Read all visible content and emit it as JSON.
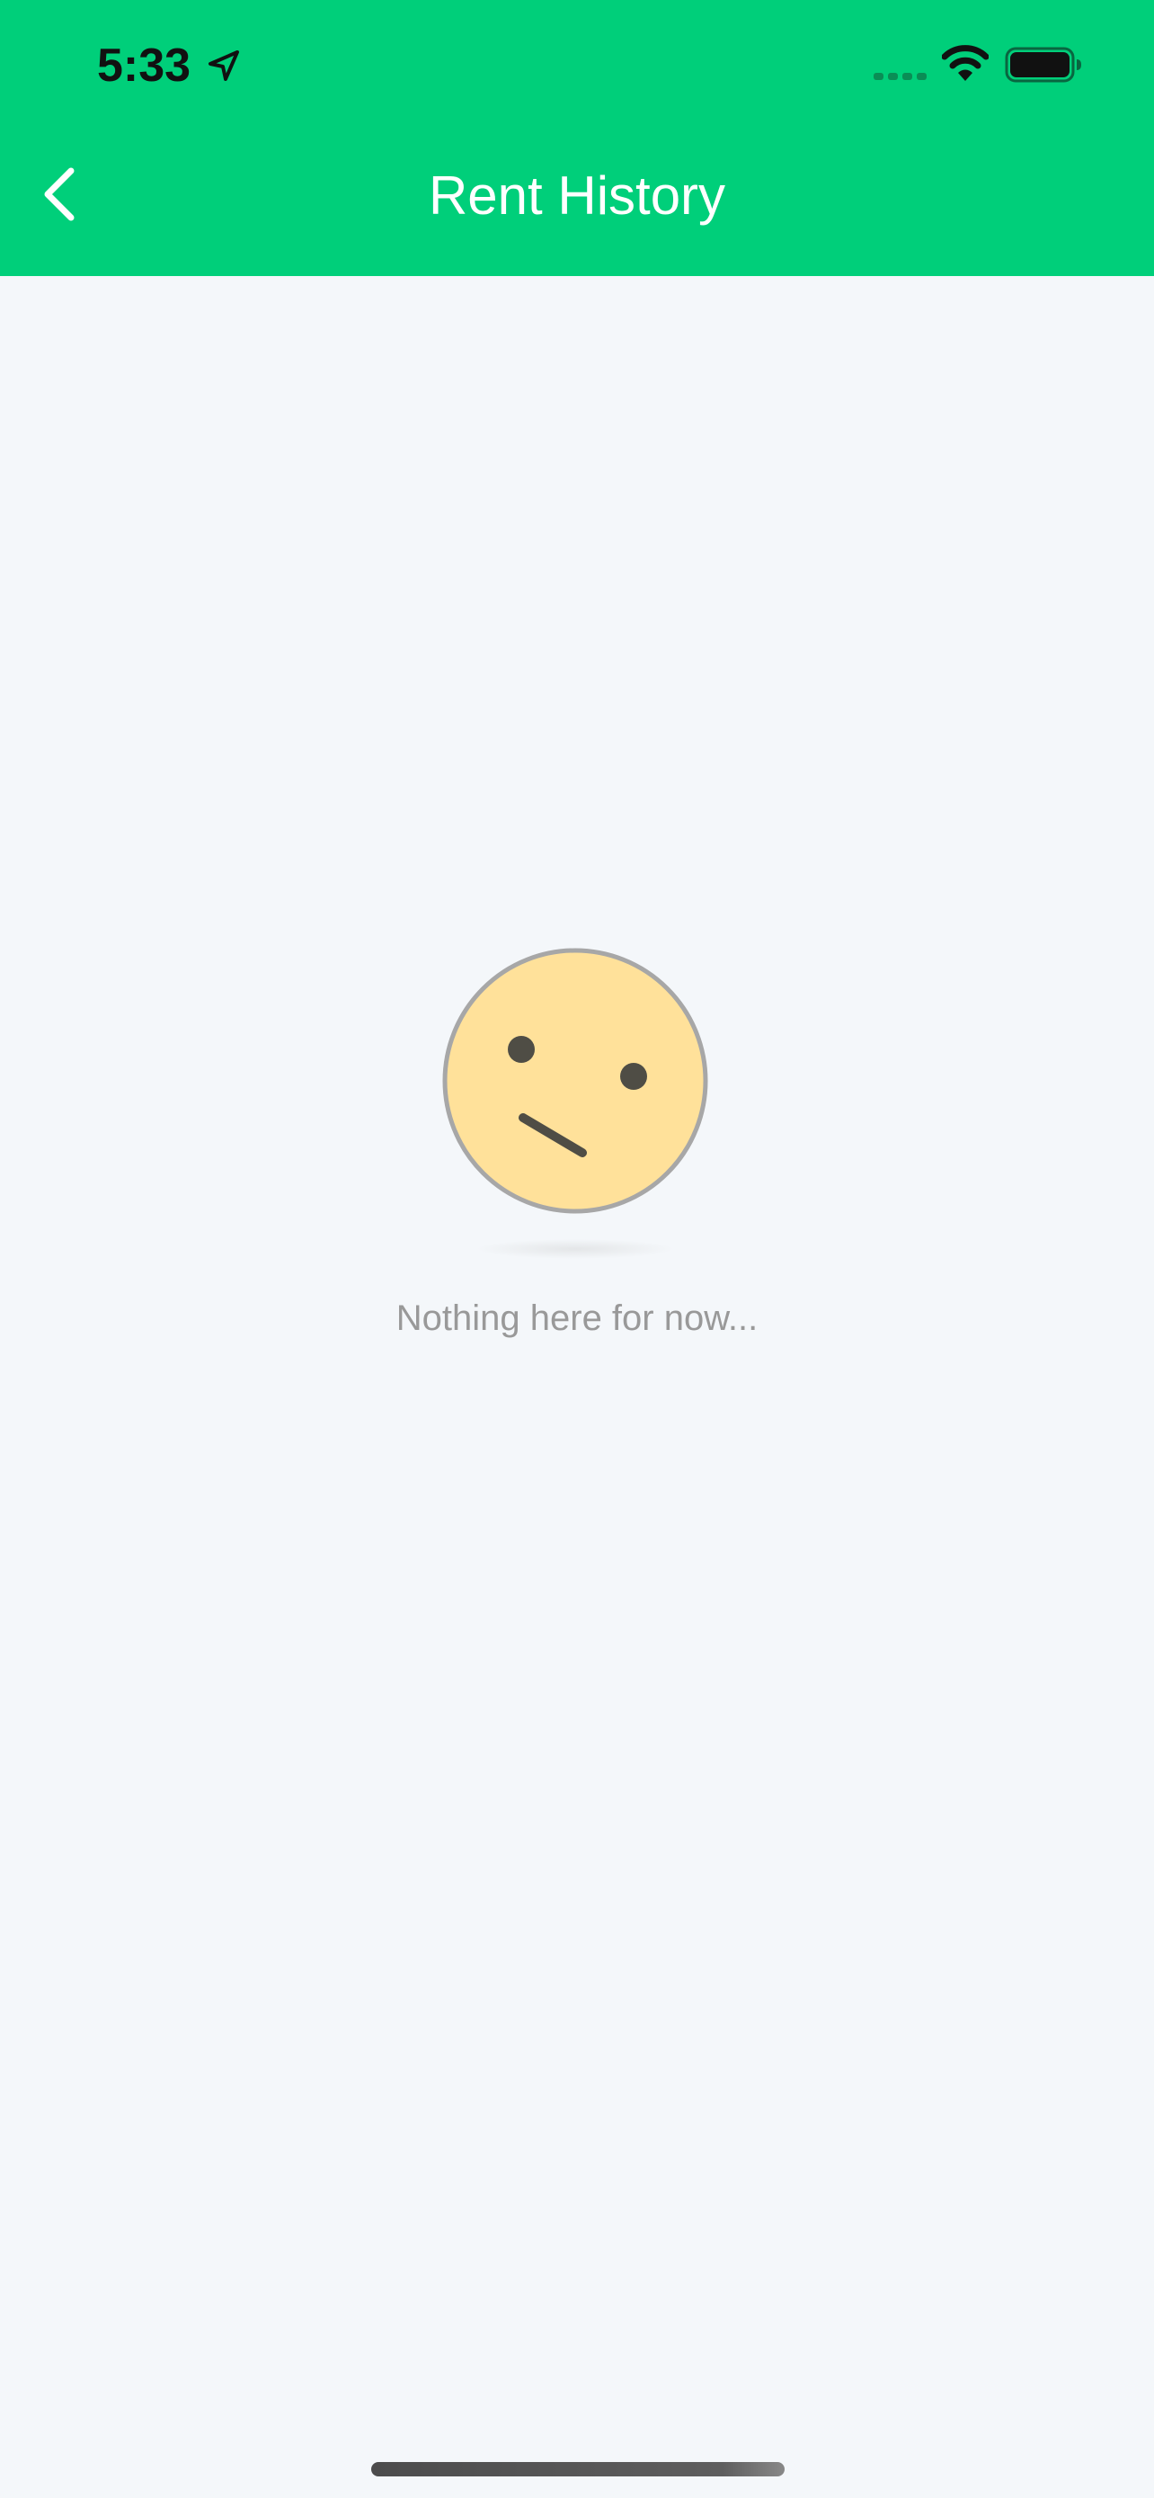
{
  "status_bar": {
    "time": "5:33",
    "icons": {
      "location": "location-arrow-icon",
      "signal": "cellular-signal-icon",
      "wifi": "wifi-icon",
      "battery": "battery-icon"
    }
  },
  "nav": {
    "title": "Rent History",
    "back_icon": "chevron-left-icon"
  },
  "empty_state": {
    "illustration": "confused-face-icon",
    "message": "Nothing here for now..."
  },
  "colors": {
    "accent": "#00cf7a",
    "background": "#f4f7fa",
    "face_fill": "#ffe19a",
    "face_outline": "#a7a7a7",
    "face_features": "#4f4d45",
    "message_text": "#999999"
  }
}
